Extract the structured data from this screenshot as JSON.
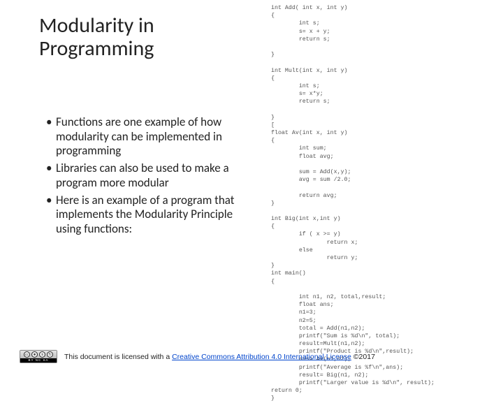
{
  "title_line1": "Modularity in",
  "title_line2": "Programming",
  "bullets": [
    "Functions are one example of how modularity can be implemented in programming",
    "Libraries can also be used to make a program more modular",
    "Here is an example of a program that implements the Modularity Principle using functions:"
  ],
  "code": "int Add( int x, int y)\n{\n        int s;\n        s= x + y;\n        return s;\n\n}\n\nint Mult(int x, int y)\n{\n        int s;\n        s= x*y;\n        return s;\n\n}\n[\nfloat Av(int x, int y)\n{\n        int sum;\n        float avg;\n\n        sum = Add(x,y);\n        avg = sum /2.0;\n\n        return avg;\n}\n\nint Big(int x,int y)\n{\n        if ( x >= y)\n                return x;\n        else\n                return y;\n}\nint main()\n{\n\n        int n1, n2, total,result;\n        float ans;\n        n1=3;\n        n2=5;\n        total = Add(n1,n2);\n        printf(\"Sum is %d\\n\", total);\n        result=Mult(n1,n2);\n        printf(\"Product is %d\\n\",result);\n        ans= Av(n1,n2);\n        printf(\"Average is %f\\n\",ans);\n        result= Big(n1, n2);\n        printf(\"Larger value is %d\\n\", result);\nreturn 0;\n}",
  "footer": {
    "prefix": "This document is licensed with a ",
    "link_text": "Creative Commons Attribution 4.0 International License",
    "suffix": " ©2017",
    "cc_label": "BY NC SA"
  }
}
